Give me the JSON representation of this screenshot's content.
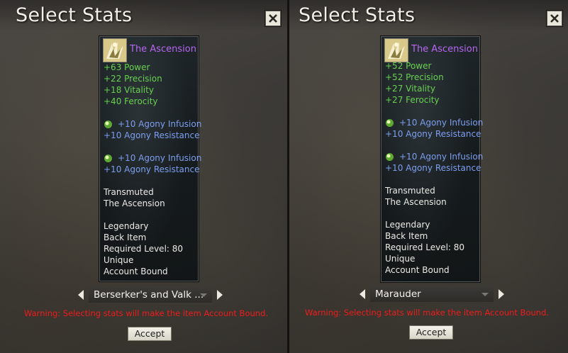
{
  "panels": [
    {
      "title": "Select Stats",
      "item": {
        "name": "The Ascension",
        "stats": [
          "+63 Power",
          "+22 Precision",
          "+18 Vitality",
          "+40 Ferocity"
        ],
        "infusions": [
          {
            "name": "+10 Agony Infusion",
            "effect": "+10 Agony Resistance"
          },
          {
            "name": "+10 Agony Infusion",
            "effect": "+10 Agony Resistance"
          }
        ],
        "transmuted_label": "Transmuted",
        "transmuted_name": "The Ascension",
        "rarity": "Legendary",
        "type": "Back Item",
        "required_level": "Required Level: 80",
        "unique": "Unique",
        "binding": "Account Bound"
      },
      "selected_stat": "Berserker's and Valk ...",
      "warning": "Warning: Selecting stats will make the item Account Bound.",
      "accept_label": "Accept"
    },
    {
      "title": "Select Stats",
      "item": {
        "name": "The Ascension",
        "stats": [
          "+52 Power",
          "+52 Precision",
          "+27 Vitality",
          "+27 Ferocity"
        ],
        "infusions": [
          {
            "name": "+10 Agony Infusion",
            "effect": "+10 Agony Resistance"
          },
          {
            "name": "+10 Agony Infusion",
            "effect": "+10 Agony Resistance"
          }
        ],
        "transmuted_label": "Transmuted",
        "transmuted_name": "The Ascension",
        "rarity": "Legendary",
        "type": "Back Item",
        "required_level": "Required Level: 80",
        "unique": "Unique",
        "binding": "Account Bound"
      },
      "selected_stat": "Marauder",
      "warning": "Warning: Selecting stats will make the item Account Bound.",
      "accept_label": "Accept"
    }
  ],
  "colors": {
    "item_name": "#b767f2",
    "stat": "#67d14f",
    "infusion": "#7d9ef0",
    "warning": "#ee1c1c"
  },
  "icons": {
    "close": "close-icon",
    "item": "item-icon",
    "infusion": "infusion-gem-icon",
    "prev": "arrow-left-icon",
    "next": "arrow-right-icon",
    "dropdown": "chevron-down-icon"
  }
}
